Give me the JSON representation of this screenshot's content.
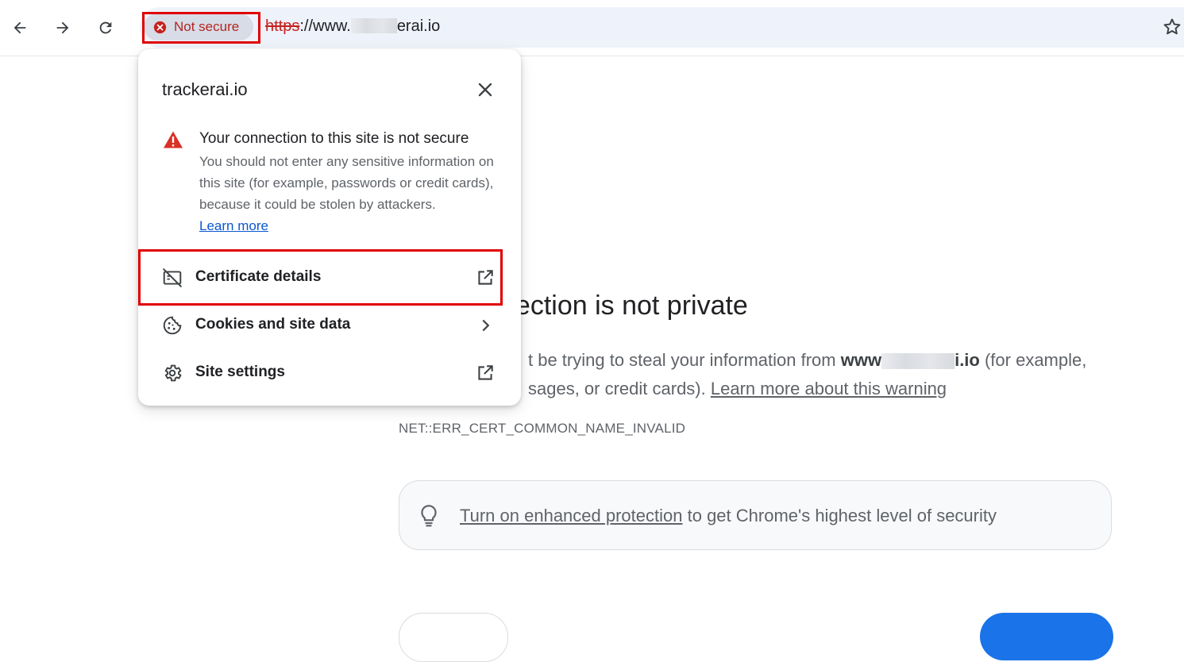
{
  "toolbar": {
    "back_icon": "arrow-left-icon",
    "forward_icon": "arrow-right-icon",
    "reload_icon": "reload-icon",
    "security_chip_label": "Not secure",
    "url_scheme": "https",
    "url_sep": "://www.",
    "url_rest": "erai.io",
    "bookmark_icon": "star-icon"
  },
  "popup": {
    "title": "trackerai.io",
    "close_icon": "close-icon",
    "warning_heading": "Your connection to this site is not secure",
    "warning_body": "You should not enter any sensitive information on this site (for example, passwords or credit cards), because it could be stolen by attackers.",
    "learn_more": "Learn more",
    "items": [
      {
        "label": "Certificate details",
        "icon": "certificate-off-icon",
        "end_icon": "open-in-new-icon"
      },
      {
        "label": "Cookies and site data",
        "icon": "cookie-icon",
        "end_icon": "chevron-right-icon"
      },
      {
        "label": "Site settings",
        "icon": "gear-icon",
        "end_icon": "open-in-new-icon"
      }
    ]
  },
  "page": {
    "title_fragment": "nection is not private",
    "body_part1": "t be trying to steal your information from ",
    "host_prefix": "www",
    "host_suffix": "i.io",
    "body_part2": " (for example,",
    "body_part3": "sages, or credit cards). ",
    "learn_more_warning": "Learn more about this warning",
    "error_code": "NET::ERR_CERT_COMMON_NAME_INVALID",
    "enhanced_link": "Turn on enhanced protection",
    "enhanced_rest": " to get Chrome's highest level of security",
    "bulb_icon": "lightbulb-icon"
  },
  "colors": {
    "not_secure_red": "#b3261e",
    "highlight_box": "#e00000",
    "link_blue": "#0b57d0",
    "primary_button": "#1a73e8"
  }
}
